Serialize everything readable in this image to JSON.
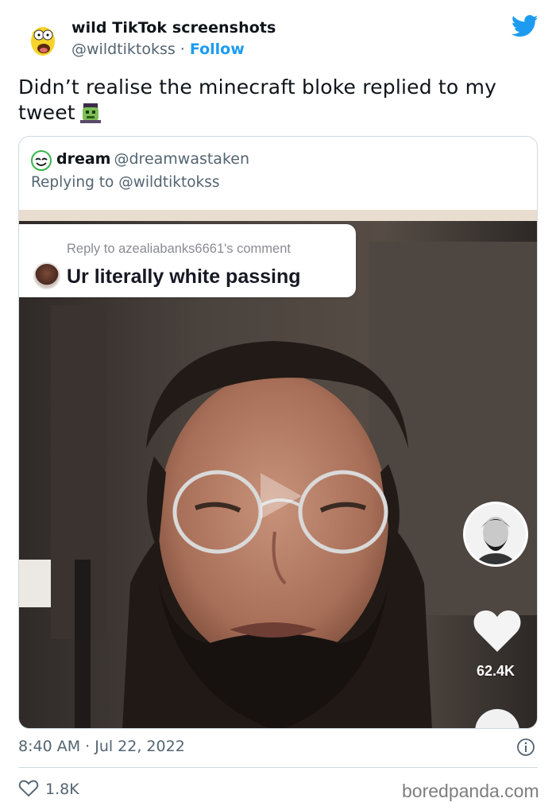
{
  "tweet": {
    "author_name": "wild TikTok screenshots",
    "author_handle": "@wildtiktokss",
    "separator": " · ",
    "follow_label": "Follow",
    "text": "Didn’t realise the minecraft bloke replied to my tweet",
    "emoji": "zombie-emoji",
    "timestamp": "8:40 AM · Jul 22, 2022",
    "likes": "1.8K"
  },
  "quoted_tweet": {
    "author_name": "dream",
    "author_handle": "@dreamwastaken",
    "replying_prefix": "Replying to ",
    "replying_to": "@wildtiktokss"
  },
  "tiktok": {
    "comment_header": "Reply to azealiabanks6661's comment",
    "comment_text": "Ur literally white passing",
    "like_count": "62.4K"
  },
  "watermark": "boredpanda.com",
  "icons": [
    "twitter-bird-icon",
    "heart-icon",
    "info-icon",
    "play-icon"
  ],
  "colors": {
    "accent": "#1d9bf0",
    "secondary_text": "#536471",
    "border": "#cfd9de"
  }
}
